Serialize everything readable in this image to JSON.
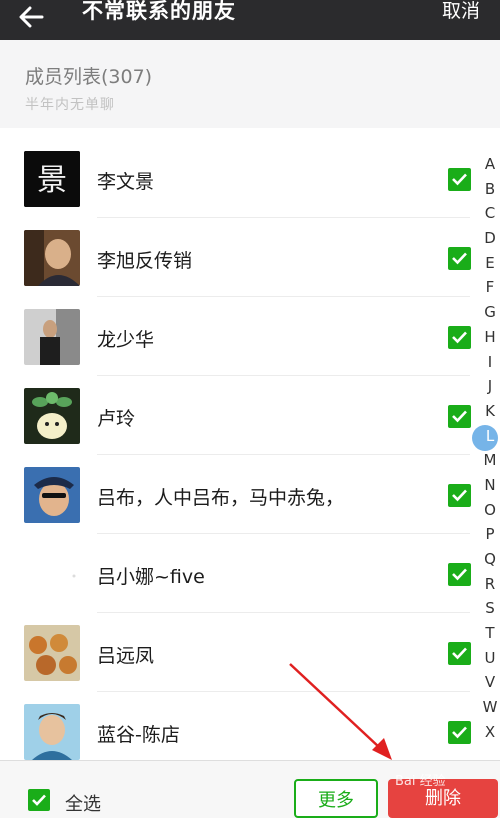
{
  "header": {
    "title": "不常联系的朋友",
    "cancel_label": "取消"
  },
  "section": {
    "member_count": "成员列表(307)",
    "subtitle": "半年内无单聊"
  },
  "contacts": [
    {
      "name": "李文景",
      "checked": true
    },
    {
      "name": "李旭反传销",
      "checked": true
    },
    {
      "name": "龙少华",
      "checked": true
    },
    {
      "name": "卢玲",
      "checked": true
    },
    {
      "name": "吕布，人中吕布，马中赤兔，",
      "checked": true
    },
    {
      "name": "吕小娜~five",
      "checked": true
    },
    {
      "name": "吕远凤",
      "checked": true
    },
    {
      "name": "蓝谷-陈店",
      "checked": true
    }
  ],
  "index_letters": [
    "A",
    "B",
    "C",
    "D",
    "E",
    "F",
    "G",
    "H",
    "I",
    "J",
    "K",
    "L",
    "M",
    "N",
    "O",
    "P",
    "Q",
    "R",
    "S",
    "T",
    "U",
    "V",
    "W",
    "X"
  ],
  "index_active": "L",
  "footer": {
    "select_all_label": "全选",
    "more_label": "更多",
    "delete_label": "删除",
    "watermark": "Bai 经验"
  },
  "colors": {
    "accent_green": "#1aad19",
    "delete_red": "#e64340",
    "topbar": "#2b2b2d",
    "index_highlight": "#76b4e8",
    "annotation_arrow": "#e02020"
  }
}
